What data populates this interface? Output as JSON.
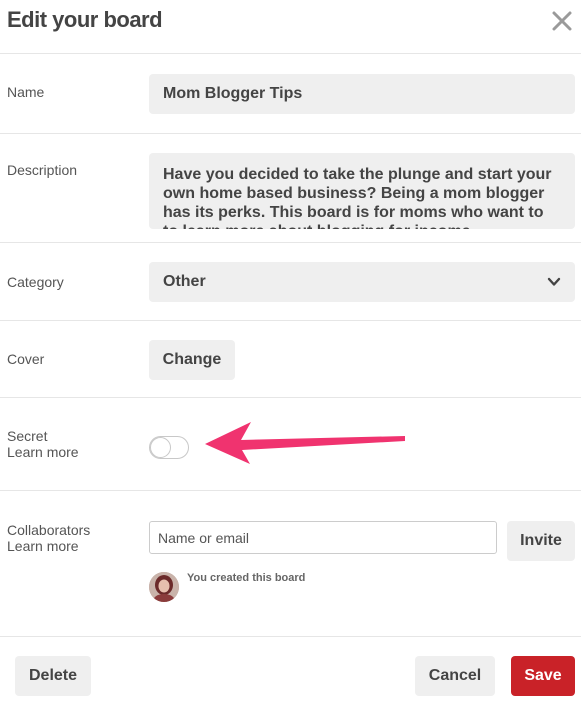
{
  "header": {
    "title": "Edit your board",
    "close_icon": "close-icon"
  },
  "name": {
    "label": "Name",
    "value": "Mom Blogger Tips"
  },
  "description": {
    "label": "Description",
    "value": "Have you decided to take the plunge and start your own home based business? Being a mom blogger has its perks. This board is for moms who want to to learn more about blogging for income."
  },
  "category": {
    "label": "Category",
    "value": "Other",
    "icon": "chevron-down-icon"
  },
  "cover": {
    "label": "Cover",
    "button_label": "Change"
  },
  "secret": {
    "label": "Secret",
    "learn_more": "Learn more",
    "enabled": false
  },
  "collaborators": {
    "label": "Collaborators",
    "learn_more": "Learn more",
    "input_placeholder": "Name or email",
    "invite_label": "Invite",
    "creator_note": "You created this board"
  },
  "footer": {
    "delete_label": "Delete",
    "cancel_label": "Cancel",
    "save_label": "Save"
  },
  "colors": {
    "save_button": "#c92228",
    "annotation_arrow": "#f0336f",
    "field_background": "#efefef"
  }
}
